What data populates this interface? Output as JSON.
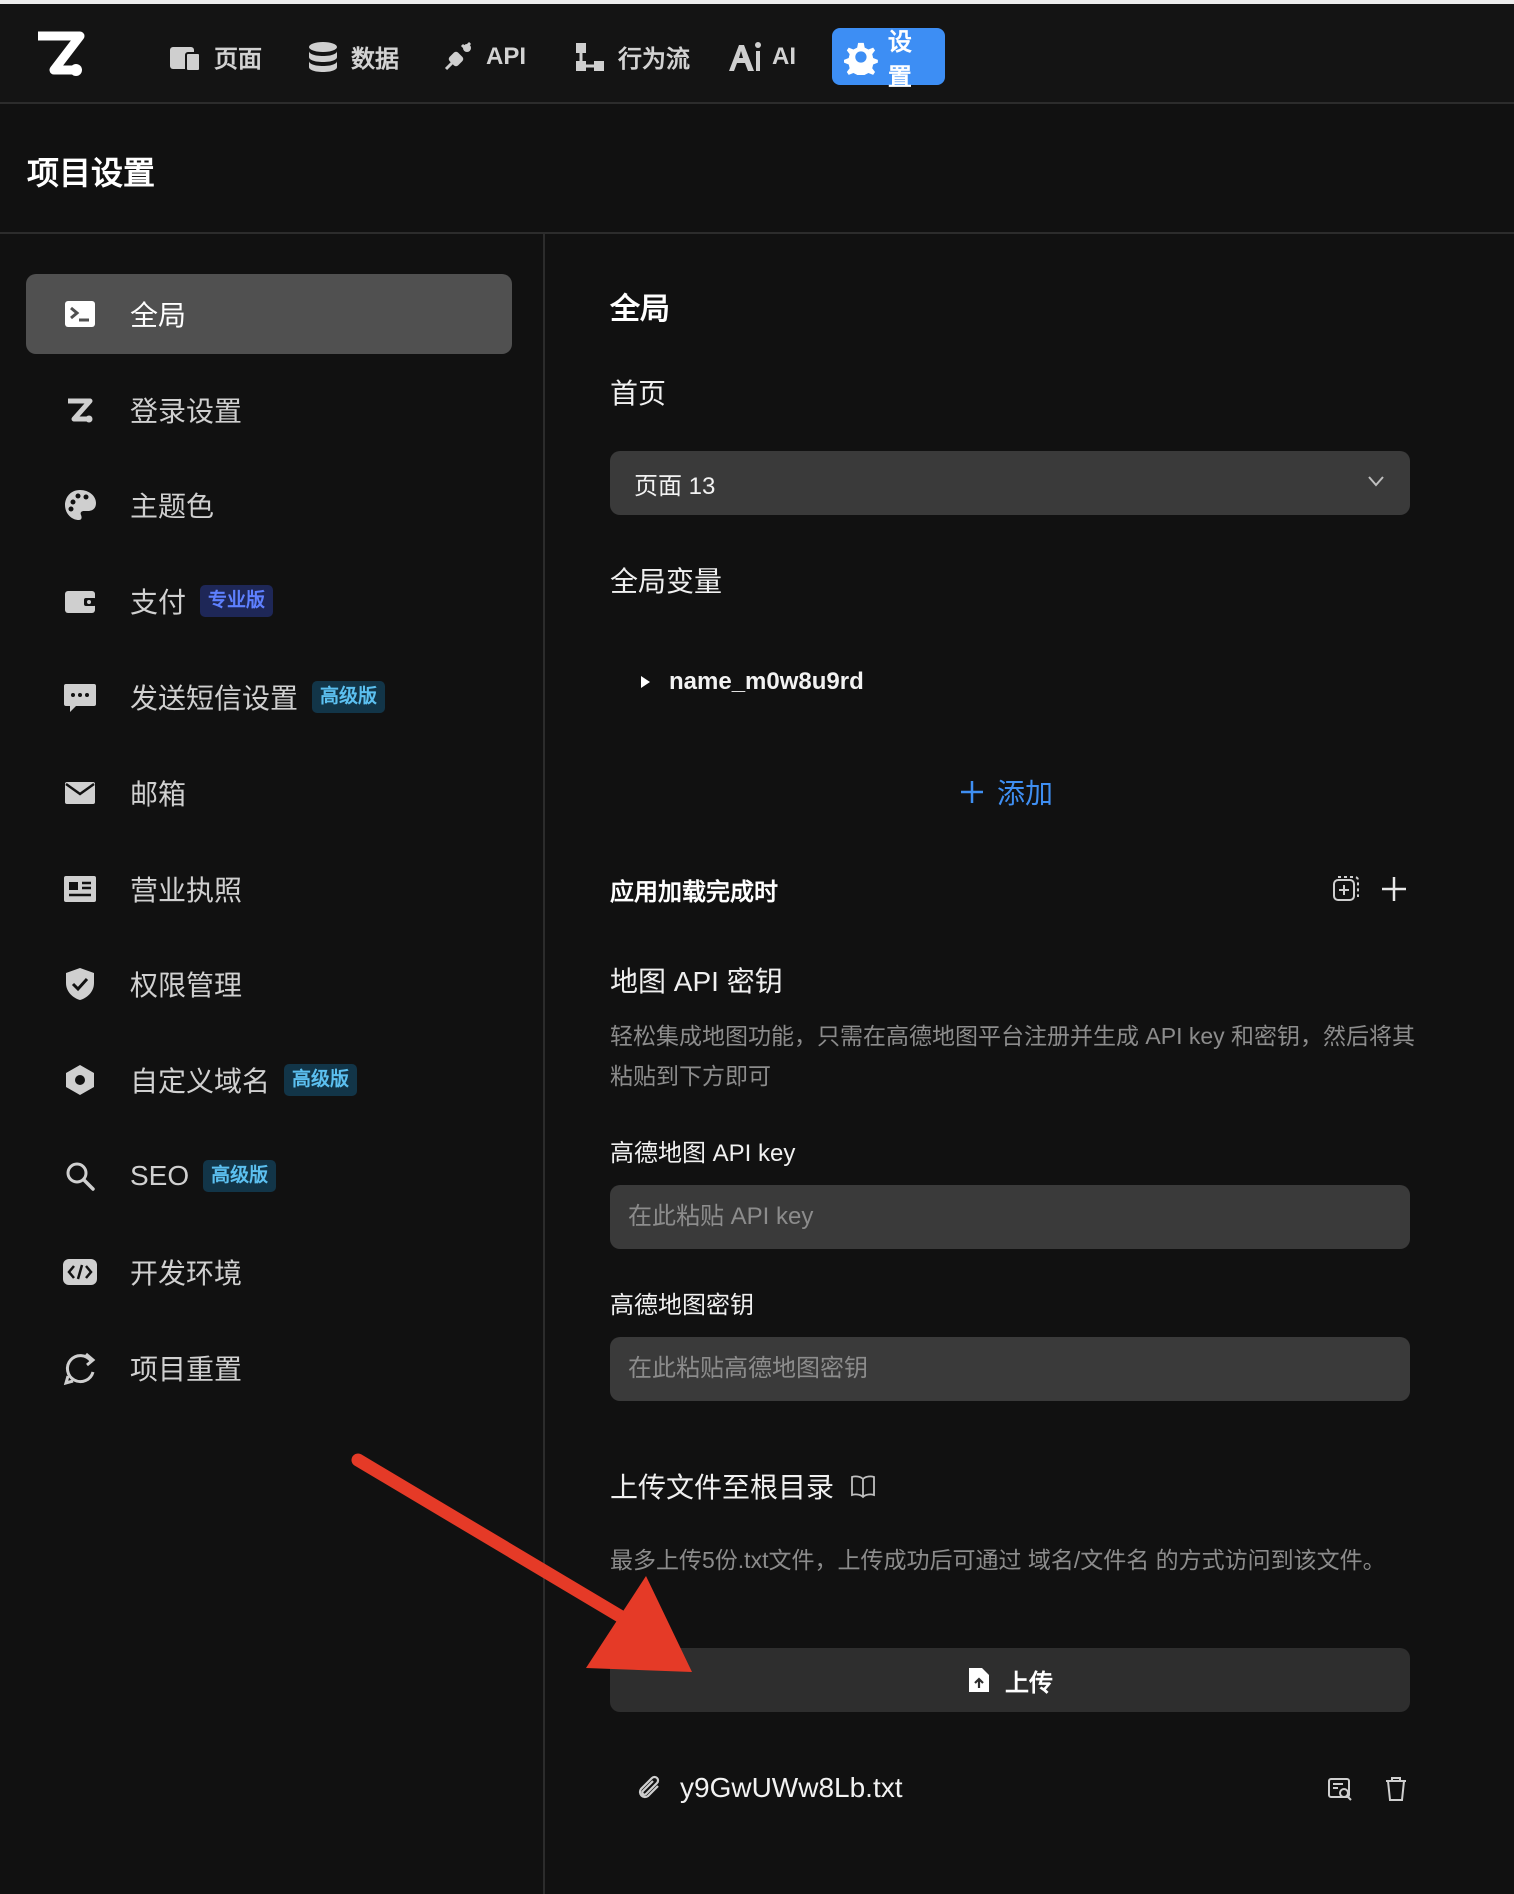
{
  "nav": {
    "items": [
      {
        "label": "页面",
        "icon": "pages-icon"
      },
      {
        "label": "数据",
        "icon": "database-icon"
      },
      {
        "label": "API",
        "icon": "plug-icon"
      },
      {
        "label": "行为流",
        "icon": "flow-icon"
      },
      {
        "label": "AI",
        "icon": "ai-icon"
      },
      {
        "label": "设置",
        "icon": "gear-icon",
        "active": true
      }
    ]
  },
  "page": {
    "title": "项目设置"
  },
  "sidebar": {
    "items": [
      {
        "label": "全局",
        "icon": "terminal-icon",
        "active": true
      },
      {
        "label": "登录设置",
        "icon": "logo-z-icon"
      },
      {
        "label": "主题色",
        "icon": "palette-icon"
      },
      {
        "label": "支付",
        "icon": "wallet-icon",
        "badge": "专业版"
      },
      {
        "label": "发送短信设置",
        "icon": "sms-icon",
        "badge": "高级版"
      },
      {
        "label": "邮箱",
        "icon": "mail-icon"
      },
      {
        "label": "营业执照",
        "icon": "license-icon"
      },
      {
        "label": "权限管理",
        "icon": "shield-icon"
      },
      {
        "label": "自定义域名",
        "icon": "hexagon-icon",
        "badge": "高级版"
      },
      {
        "label": "SEO",
        "icon": "search-icon",
        "badge": "高级版"
      },
      {
        "label": "开发环境",
        "icon": "code-icon"
      },
      {
        "label": "项目重置",
        "icon": "reset-icon"
      }
    ]
  },
  "main": {
    "section_title": "全局",
    "homepage_label": "首页",
    "homepage_value": "页面 13",
    "global_vars_label": "全局变量",
    "var_name": "name_m0w8u9rd",
    "add_label": "添加",
    "on_load_label": "应用加载完成时",
    "map_title": "地图 API 密钥",
    "map_desc": "轻松集成地图功能，只需在高德地图平台注册并生成 API key 和密钥，然后将其粘贴到下方即可",
    "api_key_label": "高德地图 API key",
    "api_key_placeholder": "在此粘贴 API key",
    "secret_label": "高德地图密钥",
    "secret_placeholder": "在此粘贴高德地图密钥",
    "upload_title": "上传文件至根目录",
    "upload_desc": "最多上传5份.txt文件，上传成功后可通过 域名/文件名 的方式访问到该文件。",
    "upload_btn": "上传",
    "file_name": "y9GwUWw8Lb.txt"
  },
  "colors": {
    "accent": "#3d8ef4",
    "link": "#3f8ff2",
    "annotation_arrow": "#e53a27"
  }
}
